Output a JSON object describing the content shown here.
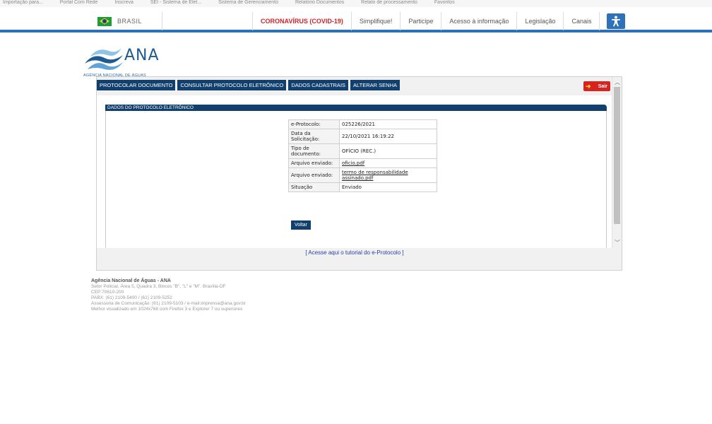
{
  "bookmarks": [
    "Importação para...",
    "Portal Com Rede",
    "Inscreva",
    "SEI - Sistema de Elet...",
    "Sistema de Gerenciamento",
    "Relatório Documentos",
    "Relato de processamento",
    "Favoritos"
  ],
  "govbar": {
    "country": "BRASIL",
    "links": [
      "CORONAVÍRUS (COVID-19)",
      "Simplifique!",
      "Participe",
      "Acesso à informação",
      "Legislação",
      "Canais"
    ],
    "covid_color": "#d32027",
    "accessibility_icon": "accessibility-icon"
  },
  "logo": {
    "name": "ANA",
    "subtitle": "AGÊNCIA NACIONAL DE ÁGUAS"
  },
  "tabs": [
    "PROTOCOLAR DOCUMENTO",
    "CONSULTAR PROTOCOLO ELETRÔNICO",
    "DADOS CADASTRAIS",
    "ALTERAR SENHA"
  ],
  "sair_label": "Sair",
  "section_title": "DADOS DO PROTOCOLO ELETRÔNICO",
  "details": [
    {
      "label": "e-Protocolo:",
      "value": "025226/2021"
    },
    {
      "label": "Data da Solicitação:",
      "value": "22/10/2021 16:19:22"
    },
    {
      "label": "Tipo de documento:",
      "value": "OFÍCIO (REC.)"
    },
    {
      "label": "Arquivo enviado:",
      "value": "oficio.pdf"
    },
    {
      "label": "Arquivo enviado:",
      "value": "termo de responsabilidade assinado.pdf"
    },
    {
      "label": "Situação",
      "value": "Enviado"
    }
  ],
  "voltar_label": "Voltar",
  "tutorial_link": "[ Acesse aqui o tutorial do e-Protocolo ]",
  "footer": {
    "org": "Agência Nacional de Águas - ANA",
    "lines": [
      "Setor Policial, Área 5, Quadra 3, Blocos \"B\", \"L\" e \"M\". Brasília-DF",
      "CEP:70610-200",
      "PABX: (61) 2109-5400 / (61) 2109-5252",
      "Assessoria de Comunicação: (61) 2109-5103 / e-mail:imprensa@ana.gov.br",
      "Melhor visualizado em 1024x768 com Firefox 3 e Explorer 7 ou superiores"
    ]
  },
  "colors": {
    "navy": "#12406e",
    "gov_blue": "#2e71b8",
    "link_blue": "#2a3e9c"
  }
}
